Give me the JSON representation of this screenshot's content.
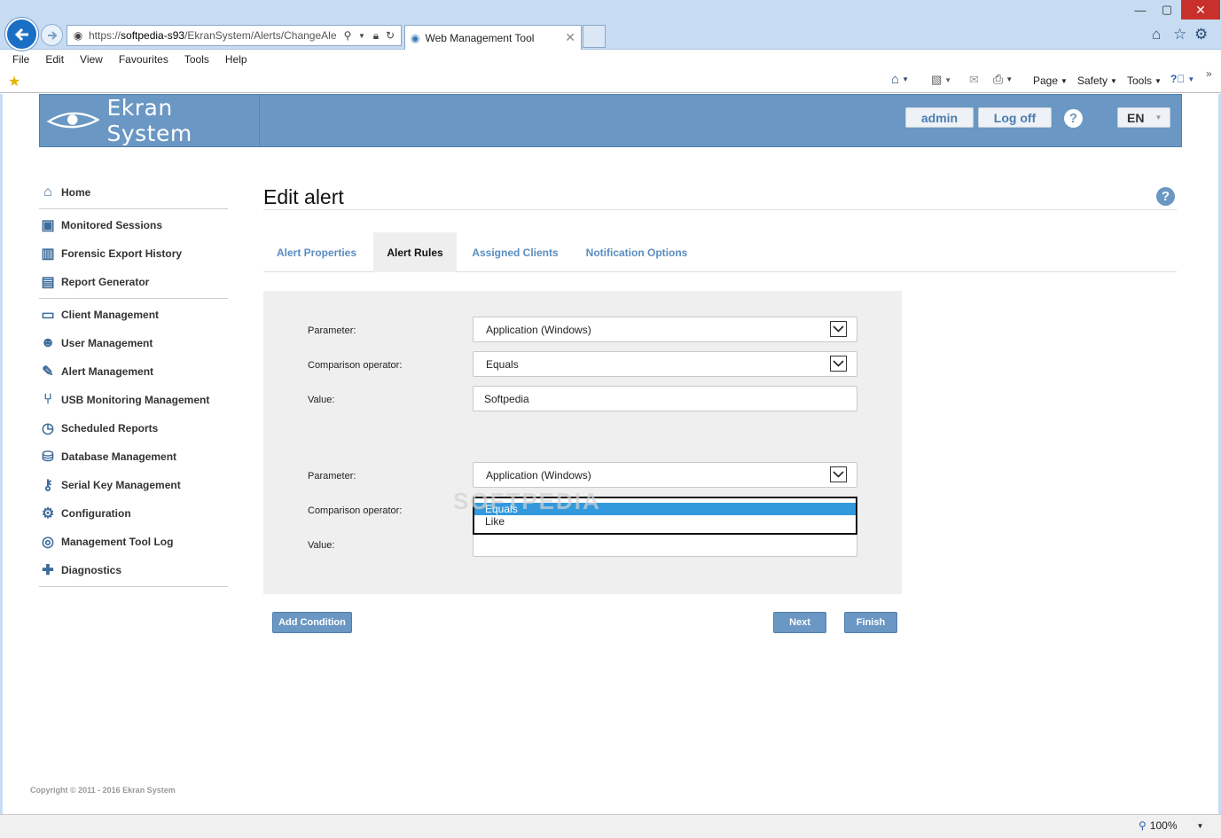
{
  "browser": {
    "url_prefix": "https://",
    "url_host": "softpedia-s93",
    "url_path": "/EkranSystem/Alerts/ChangeAle",
    "tab_title": "Web Management Tool",
    "menu": [
      "File",
      "Edit",
      "View",
      "Favourites",
      "Tools",
      "Help"
    ],
    "cmd": {
      "page": "Page",
      "safety": "Safety",
      "tools": "Tools"
    },
    "zoom": "100%"
  },
  "header": {
    "brand": "Ekran System",
    "user": "admin",
    "logoff": "Log off",
    "help": "?",
    "lang": "EN"
  },
  "sidebar": {
    "items": [
      {
        "label": "Home",
        "icon": "home-icon"
      },
      {
        "label": "Monitored Sessions",
        "icon": "monitor-icon"
      },
      {
        "label": "Forensic Export History",
        "icon": "film-icon"
      },
      {
        "label": "Report Generator",
        "icon": "report-icon"
      },
      {
        "label": "Client Management",
        "icon": "client-icon"
      },
      {
        "label": "User Management",
        "icon": "users-icon"
      },
      {
        "label": "Alert Management",
        "icon": "alert-icon"
      },
      {
        "label": "USB Monitoring Management",
        "icon": "usb-icon"
      },
      {
        "label": "Scheduled Reports",
        "icon": "clock-icon"
      },
      {
        "label": "Database Management",
        "icon": "database-icon"
      },
      {
        "label": "Serial Key Management",
        "icon": "key-icon"
      },
      {
        "label": "Configuration",
        "icon": "gear-icon"
      },
      {
        "label": "Management Tool Log",
        "icon": "log-icon"
      },
      {
        "label": "Diagnostics",
        "icon": "diagnostics-icon"
      }
    ]
  },
  "main": {
    "title": "Edit alert",
    "help": "?",
    "tabs": [
      {
        "label": "Alert Properties",
        "active": false
      },
      {
        "label": "Alert Rules",
        "active": true
      },
      {
        "label": "Assigned Clients",
        "active": false
      },
      {
        "label": "Notification Options",
        "active": false
      }
    ],
    "rules": [
      {
        "parameter_label": "Parameter:",
        "parameter_value": "Application (Windows)",
        "operator_label": "Comparison operator:",
        "operator_value": "Equals",
        "value_label": "Value:",
        "value": "Softpedia"
      },
      {
        "parameter_label": "Parameter:",
        "parameter_value": "Application (Windows)",
        "operator_label": "Comparison operator:",
        "operator_options": [
          "Equals",
          "Like"
        ],
        "value_label": "Value:",
        "value": ""
      }
    ],
    "buttons": {
      "add_condition": "Add Condition",
      "next": "Next",
      "finish": "Finish"
    }
  },
  "footer": {
    "copyright": "Copyright © 2011 - 2016 Ekran System"
  },
  "watermark": "SOFTPEDIA",
  "colors": {
    "brand": "#6a97c3",
    "link": "#5a8dc0",
    "highlight": "#3399dd"
  }
}
